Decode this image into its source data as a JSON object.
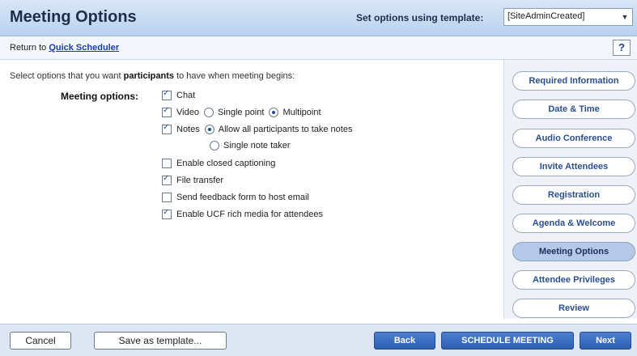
{
  "header": {
    "title": "Meeting Options",
    "template_label": "Set options using template:",
    "template_value": "[SiteAdminCreated]"
  },
  "subbar": {
    "return_prefix": "Return to",
    "return_link": "Quick Scheduler",
    "help_label": "?"
  },
  "main": {
    "intro_prefix": "Select options that you want",
    "intro_bold": "participants",
    "intro_suffix": "to have when meeting begins:",
    "options_label": "Meeting options:",
    "chat": "Chat",
    "video": "Video",
    "video_single": "Single point",
    "video_multi": "Multipoint",
    "notes": "Notes",
    "notes_all": "Allow all participants to take notes",
    "notes_single": "Single note taker",
    "closed_captioning": "Enable closed captioning",
    "file_transfer": "File transfer",
    "feedback_form": "Send feedback form to host email",
    "ucf_media": "Enable UCF rich media for attendees"
  },
  "nav": {
    "items": [
      {
        "label": "Required Information",
        "active": false
      },
      {
        "label": "Date & Time",
        "active": false
      },
      {
        "label": "Audio Conference",
        "active": false
      },
      {
        "label": "Invite Attendees",
        "active": false
      },
      {
        "label": "Registration",
        "active": false
      },
      {
        "label": "Agenda & Welcome",
        "active": false
      },
      {
        "label": "Meeting Options",
        "active": true
      },
      {
        "label": "Attendee Privileges",
        "active": false
      },
      {
        "label": "Review",
        "active": false
      }
    ]
  },
  "footer": {
    "cancel": "Cancel",
    "save_template": "Save as template...",
    "back": "Back",
    "schedule": "SCHEDULE MEETING",
    "next": "Next"
  },
  "icons": {
    "dropdown": "chevron-down-icon",
    "help": "question-icon"
  }
}
